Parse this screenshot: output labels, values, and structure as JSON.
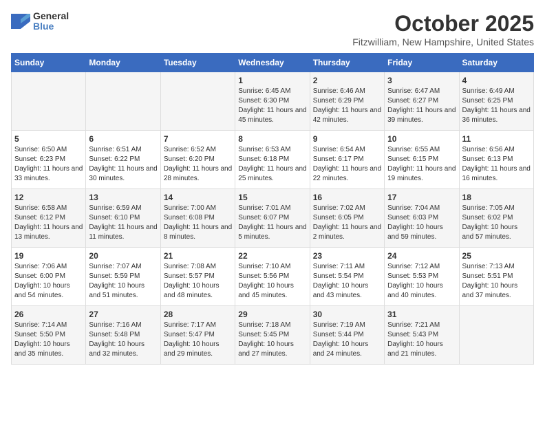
{
  "header": {
    "logo_general": "General",
    "logo_blue": "Blue",
    "month": "October 2025",
    "location": "Fitzwilliam, New Hampshire, United States"
  },
  "days_of_week": [
    "Sunday",
    "Monday",
    "Tuesday",
    "Wednesday",
    "Thursday",
    "Friday",
    "Saturday"
  ],
  "weeks": [
    [
      {
        "day": "",
        "info": ""
      },
      {
        "day": "",
        "info": ""
      },
      {
        "day": "",
        "info": ""
      },
      {
        "day": "1",
        "info": "Sunrise: 6:45 AM\nSunset: 6:30 PM\nDaylight: 11 hours and 45 minutes."
      },
      {
        "day": "2",
        "info": "Sunrise: 6:46 AM\nSunset: 6:29 PM\nDaylight: 11 hours and 42 minutes."
      },
      {
        "day": "3",
        "info": "Sunrise: 6:47 AM\nSunset: 6:27 PM\nDaylight: 11 hours and 39 minutes."
      },
      {
        "day": "4",
        "info": "Sunrise: 6:49 AM\nSunset: 6:25 PM\nDaylight: 11 hours and 36 minutes."
      }
    ],
    [
      {
        "day": "5",
        "info": "Sunrise: 6:50 AM\nSunset: 6:23 PM\nDaylight: 11 hours and 33 minutes."
      },
      {
        "day": "6",
        "info": "Sunrise: 6:51 AM\nSunset: 6:22 PM\nDaylight: 11 hours and 30 minutes."
      },
      {
        "day": "7",
        "info": "Sunrise: 6:52 AM\nSunset: 6:20 PM\nDaylight: 11 hours and 28 minutes."
      },
      {
        "day": "8",
        "info": "Sunrise: 6:53 AM\nSunset: 6:18 PM\nDaylight: 11 hours and 25 minutes."
      },
      {
        "day": "9",
        "info": "Sunrise: 6:54 AM\nSunset: 6:17 PM\nDaylight: 11 hours and 22 minutes."
      },
      {
        "day": "10",
        "info": "Sunrise: 6:55 AM\nSunset: 6:15 PM\nDaylight: 11 hours and 19 minutes."
      },
      {
        "day": "11",
        "info": "Sunrise: 6:56 AM\nSunset: 6:13 PM\nDaylight: 11 hours and 16 minutes."
      }
    ],
    [
      {
        "day": "12",
        "info": "Sunrise: 6:58 AM\nSunset: 6:12 PM\nDaylight: 11 hours and 13 minutes."
      },
      {
        "day": "13",
        "info": "Sunrise: 6:59 AM\nSunset: 6:10 PM\nDaylight: 11 hours and 11 minutes."
      },
      {
        "day": "14",
        "info": "Sunrise: 7:00 AM\nSunset: 6:08 PM\nDaylight: 11 hours and 8 minutes."
      },
      {
        "day": "15",
        "info": "Sunrise: 7:01 AM\nSunset: 6:07 PM\nDaylight: 11 hours and 5 minutes."
      },
      {
        "day": "16",
        "info": "Sunrise: 7:02 AM\nSunset: 6:05 PM\nDaylight: 11 hours and 2 minutes."
      },
      {
        "day": "17",
        "info": "Sunrise: 7:04 AM\nSunset: 6:03 PM\nDaylight: 10 hours and 59 minutes."
      },
      {
        "day": "18",
        "info": "Sunrise: 7:05 AM\nSunset: 6:02 PM\nDaylight: 10 hours and 57 minutes."
      }
    ],
    [
      {
        "day": "19",
        "info": "Sunrise: 7:06 AM\nSunset: 6:00 PM\nDaylight: 10 hours and 54 minutes."
      },
      {
        "day": "20",
        "info": "Sunrise: 7:07 AM\nSunset: 5:59 PM\nDaylight: 10 hours and 51 minutes."
      },
      {
        "day": "21",
        "info": "Sunrise: 7:08 AM\nSunset: 5:57 PM\nDaylight: 10 hours and 48 minutes."
      },
      {
        "day": "22",
        "info": "Sunrise: 7:10 AM\nSunset: 5:56 PM\nDaylight: 10 hours and 45 minutes."
      },
      {
        "day": "23",
        "info": "Sunrise: 7:11 AM\nSunset: 5:54 PM\nDaylight: 10 hours and 43 minutes."
      },
      {
        "day": "24",
        "info": "Sunrise: 7:12 AM\nSunset: 5:53 PM\nDaylight: 10 hours and 40 minutes."
      },
      {
        "day": "25",
        "info": "Sunrise: 7:13 AM\nSunset: 5:51 PM\nDaylight: 10 hours and 37 minutes."
      }
    ],
    [
      {
        "day": "26",
        "info": "Sunrise: 7:14 AM\nSunset: 5:50 PM\nDaylight: 10 hours and 35 minutes."
      },
      {
        "day": "27",
        "info": "Sunrise: 7:16 AM\nSunset: 5:48 PM\nDaylight: 10 hours and 32 minutes."
      },
      {
        "day": "28",
        "info": "Sunrise: 7:17 AM\nSunset: 5:47 PM\nDaylight: 10 hours and 29 minutes."
      },
      {
        "day": "29",
        "info": "Sunrise: 7:18 AM\nSunset: 5:45 PM\nDaylight: 10 hours and 27 minutes."
      },
      {
        "day": "30",
        "info": "Sunrise: 7:19 AM\nSunset: 5:44 PM\nDaylight: 10 hours and 24 minutes."
      },
      {
        "day": "31",
        "info": "Sunrise: 7:21 AM\nSunset: 5:43 PM\nDaylight: 10 hours and 21 minutes."
      },
      {
        "day": "",
        "info": ""
      }
    ]
  ]
}
